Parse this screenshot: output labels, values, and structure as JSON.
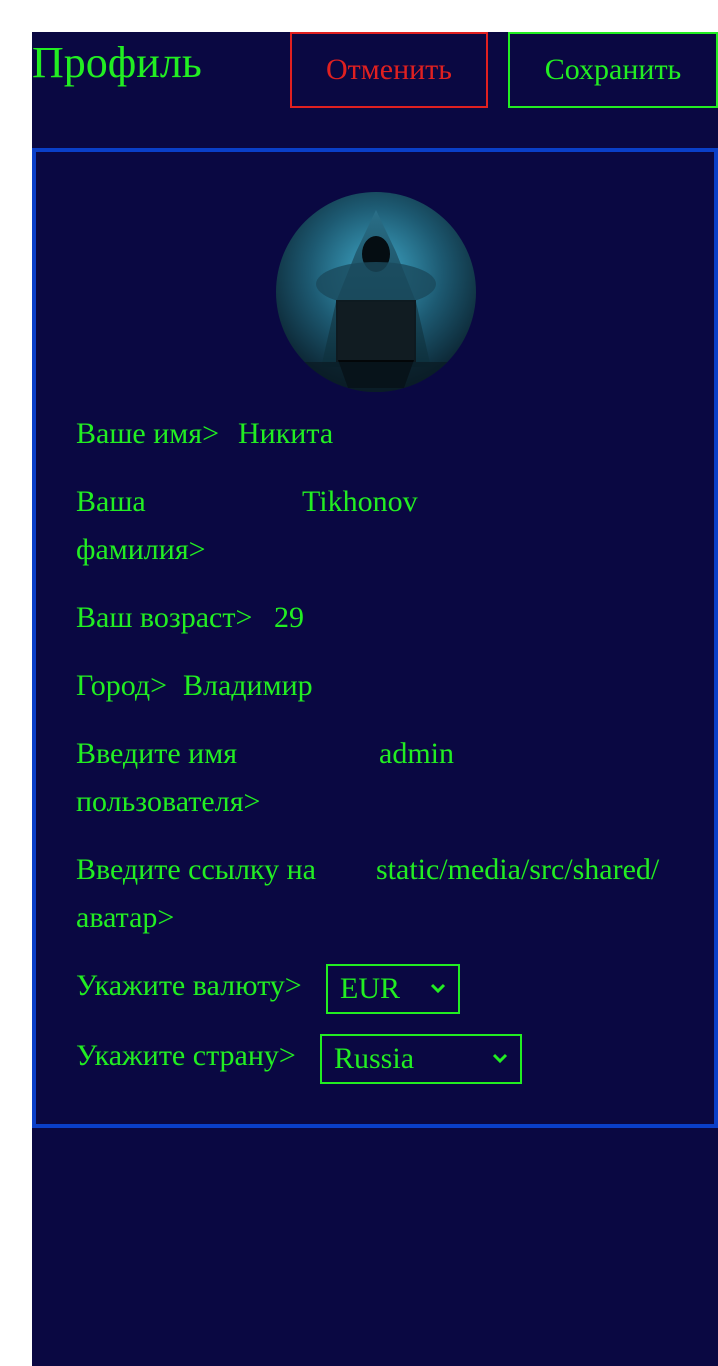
{
  "header": {
    "title": "Профиль",
    "cancel_label": "Отменить",
    "save_label": "Сохранить"
  },
  "profile": {
    "first_name": {
      "label": "Ваше имя>",
      "value": "Никита"
    },
    "last_name": {
      "label": "Ваша фамилия>",
      "value": "Tikhonov"
    },
    "age": {
      "label": "Ваш возраст>",
      "value": "29"
    },
    "city": {
      "label": "Город>",
      "value": "Владимир"
    },
    "username": {
      "label": "Введите имя пользователя>",
      "value": "admin"
    },
    "avatar_url": {
      "label": "Введите ссылку на аватар>",
      "value": "static/media/src/shared/"
    },
    "currency": {
      "label": "Укажите валюту>",
      "selected": "EUR"
    },
    "country": {
      "label": "Укажите страну>",
      "selected": "Russia"
    }
  },
  "colors": {
    "background": "#0a0842",
    "text": "#22ee22",
    "cancel": "#e02020",
    "card_border": "#0a3fc8"
  },
  "icons": {
    "avatar": "hooded-hacker-avatar",
    "select_arrow": "chevron-down-icon"
  }
}
